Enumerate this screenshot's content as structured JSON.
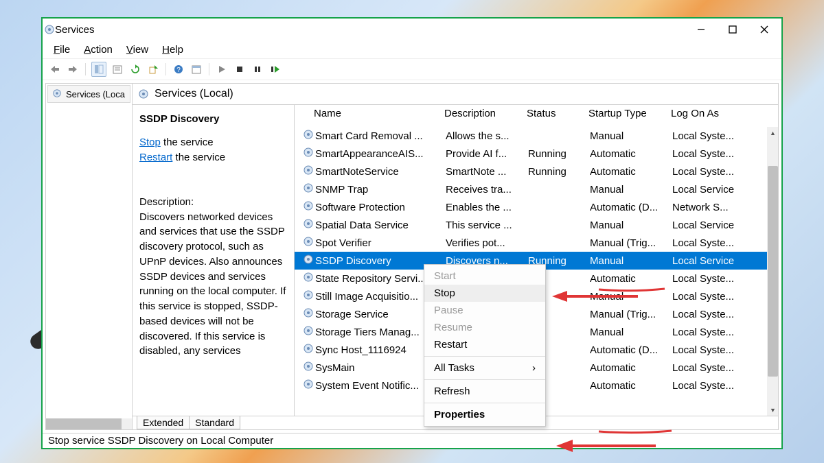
{
  "window": {
    "title": "Services"
  },
  "menu": {
    "file": "File",
    "action": "Action",
    "view": "View",
    "help": "Help"
  },
  "tree": {
    "rootLabel": "Services (Loca"
  },
  "header": {
    "localLabel": "Services (Local)"
  },
  "details": {
    "serviceName": "SSDP Discovery",
    "stopLink": "Stop",
    "stopSuffix": "the service",
    "restartLink": "Restart",
    "restartSuffix": "the service",
    "descHead": "Description:",
    "description": "Discovers networked devices and services that use the SSDP discovery protocol, such as UPnP devices. Also announces SSDP devices and services running on the local computer. If this service is stopped, SSDP-based devices will not be discovered. If this service is disabled, any services"
  },
  "columns": {
    "name": "Name",
    "desc": "Description",
    "status": "Status",
    "startup": "Startup Type",
    "log": "Log On As"
  },
  "rows": [
    {
      "name": "Smart Card Removal ...",
      "desc": "Allows the s...",
      "status": "",
      "startup": "Manual",
      "log": "Local Syste..."
    },
    {
      "name": "SmartAppearanceAIS...",
      "desc": "Provide AI f...",
      "status": "Running",
      "startup": "Automatic",
      "log": "Local Syste..."
    },
    {
      "name": "SmartNoteService",
      "desc": "SmartNote ...",
      "status": "Running",
      "startup": "Automatic",
      "log": "Local Syste..."
    },
    {
      "name": "SNMP Trap",
      "desc": "Receives tra...",
      "status": "",
      "startup": "Manual",
      "log": "Local Service"
    },
    {
      "name": "Software Protection",
      "desc": "Enables the ...",
      "status": "",
      "startup": "Automatic (D...",
      "log": "Network S..."
    },
    {
      "name": "Spatial Data Service",
      "desc": "This service ...",
      "status": "",
      "startup": "Manual",
      "log": "Local Service"
    },
    {
      "name": "Spot Verifier",
      "desc": "Verifies pot...",
      "status": "",
      "startup": "Manual (Trig...",
      "log": "Local Syste..."
    },
    {
      "name": "SSDP Discovery",
      "desc": "Discovers n...",
      "status": "Running",
      "startup": "Manual",
      "log": "Local Service",
      "selected": true
    },
    {
      "name": "State Repository Servi...",
      "desc": "",
      "status": "",
      "startup": "Automatic",
      "log": "Local Syste..."
    },
    {
      "name": "Still Image Acquisitio...",
      "desc": "",
      "status": "",
      "startup": "Manual",
      "log": "Local Syste..."
    },
    {
      "name": "Storage Service",
      "desc": "",
      "status": "",
      "startup": "Manual (Trig...",
      "log": "Local Syste..."
    },
    {
      "name": "Storage Tiers Manag...",
      "desc": "",
      "status": "",
      "startup": "Manual",
      "log": "Local Syste..."
    },
    {
      "name": "Sync Host_1116924",
      "desc": "",
      "status": "",
      "startup": "Automatic (D...",
      "log": "Local Syste..."
    },
    {
      "name": "SysMain",
      "desc": "",
      "status": "",
      "startup": "Automatic",
      "log": "Local Syste..."
    },
    {
      "name": "System Event Notific...",
      "desc": "",
      "status": "",
      "startup": "Automatic",
      "log": "Local Syste..."
    }
  ],
  "tabs": {
    "extended": "Extended",
    "standard": "Standard"
  },
  "statusBar": "Stop service SSDP Discovery on Local Computer",
  "context": {
    "start": "Start",
    "stop": "Stop",
    "pause": "Pause",
    "resume": "Resume",
    "restart": "Restart",
    "allTasks": "All Tasks",
    "refresh": "Refresh",
    "properties": "Properties"
  }
}
